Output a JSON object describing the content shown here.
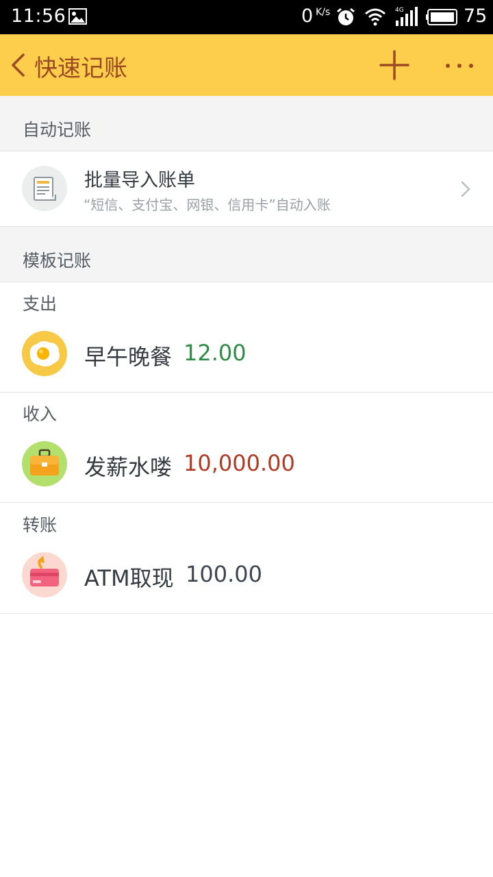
{
  "status_bar": {
    "time": "11:56",
    "net_speed": "0",
    "net_speed_unit": "K/s",
    "battery": "75"
  },
  "header": {
    "title": "快速记账",
    "accent_color": "#fcce4c",
    "title_color": "#9b4a22"
  },
  "auto_section": {
    "title": "自动记账",
    "import": {
      "title": "批量导入账单",
      "subtitle": "“短信、支付宝、网银、信用卡”自动入账",
      "icon": "document-icon"
    }
  },
  "template_section": {
    "title": "模板记账",
    "groups": [
      {
        "label": "支出",
        "item": {
          "name": "早午晚餐",
          "amount": "12.00",
          "amount_color": "#2e8b45",
          "icon": "fried-egg-icon"
        }
      },
      {
        "label": "收入",
        "item": {
          "name": "发薪水喽",
          "amount": "10,000.00",
          "amount_color": "#b03a24",
          "icon": "briefcase-icon"
        }
      },
      {
        "label": "转账",
        "item": {
          "name": "ATM取现",
          "amount": "100.00",
          "amount_color": "#3d4650",
          "icon": "card-withdraw-icon"
        }
      }
    ]
  }
}
